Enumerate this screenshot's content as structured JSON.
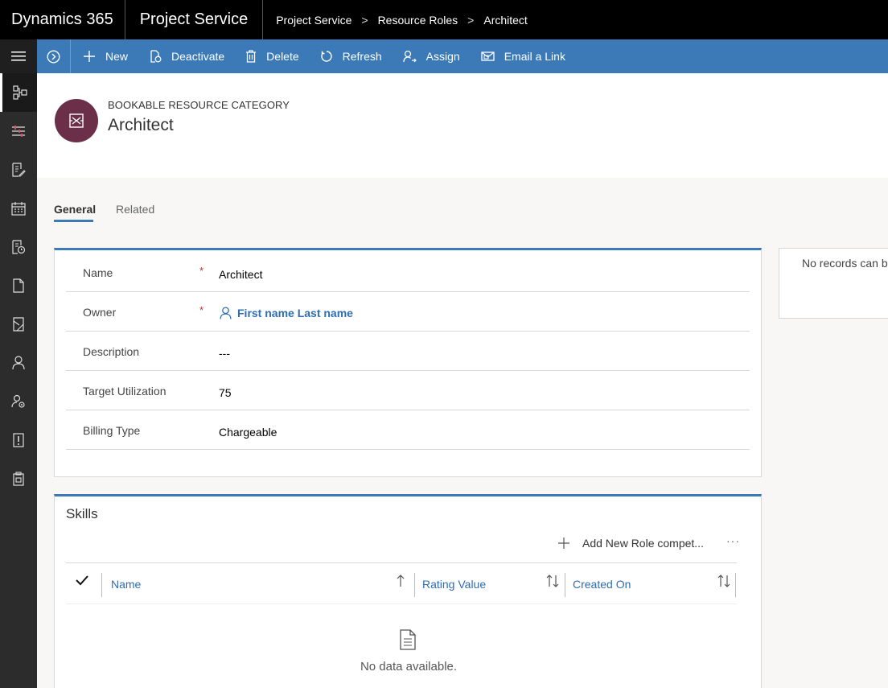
{
  "topbar": {
    "app_name": "Dynamics 365",
    "module_name": "Project Service",
    "breadcrumb": [
      "Project Service",
      "Resource Roles",
      "Architect"
    ],
    "separator": ">"
  },
  "commandbar": {
    "buttons": [
      {
        "label": "New",
        "icon": "plus-icon"
      },
      {
        "label": "Deactivate",
        "icon": "deactivate-icon"
      },
      {
        "label": "Delete",
        "icon": "trash-icon"
      },
      {
        "label": "Refresh",
        "icon": "refresh-icon"
      },
      {
        "label": "Assign",
        "icon": "assign-icon"
      },
      {
        "label": "Email a Link",
        "icon": "email-link-icon"
      }
    ]
  },
  "record": {
    "entity_type": "BOOKABLE RESOURCE CATEGORY",
    "title": "Architect",
    "avatar_color": "#6b2f4a"
  },
  "tabs": {
    "general": "General",
    "related": "Related"
  },
  "form": {
    "fields": [
      {
        "label": "Name",
        "required": "*",
        "value": "Architect"
      },
      {
        "label": "Owner",
        "required": "*",
        "value": "First name Last name"
      },
      {
        "label": "Description",
        "required": "",
        "value": "---"
      },
      {
        "label": "Target Utilization",
        "required": "",
        "value": "75"
      },
      {
        "label": "Billing Type",
        "required": "",
        "value": "Chargeable"
      }
    ]
  },
  "side_panel": {
    "message": "No records can b"
  },
  "skills": {
    "title": "Skills",
    "add_label": "Add New Role compet...",
    "more": "···",
    "columns": [
      "Name",
      "Rating Value",
      "Created On"
    ],
    "empty_message": "No data available."
  },
  "colors": {
    "accent": "#3b79b7",
    "link": "#2e6db4",
    "required": "#b83b3b"
  }
}
